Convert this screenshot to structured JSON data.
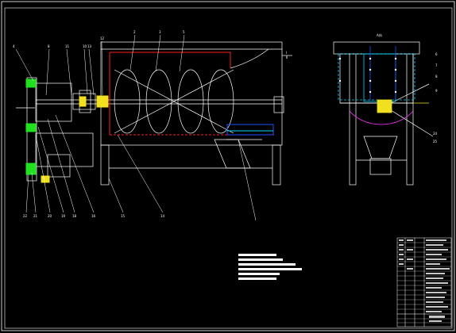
{
  "drawing": {
    "view_label": "A向",
    "side_labels": [
      "Ⅰ",
      "Ⅱ"
    ],
    "left_callouts": [
      "4",
      "8",
      "11",
      "10",
      "13",
      "12"
    ],
    "bottom_callouts": [
      "22",
      "21",
      "20",
      "19",
      "18",
      "16",
      "15",
      "14"
    ],
    "top_callouts": [
      "2",
      "3",
      "5"
    ],
    "right_callouts": [
      "6",
      "7",
      "8",
      "9",
      "24",
      "25"
    ],
    "colors": {
      "background": "#000000",
      "lines": "#ffffff",
      "red": "#ff2020",
      "cyan": "#00d8ff",
      "blue": "#2050ff",
      "yellow": "#f0e020",
      "green": "#20e020",
      "magenta": "#ff30ff"
    }
  }
}
